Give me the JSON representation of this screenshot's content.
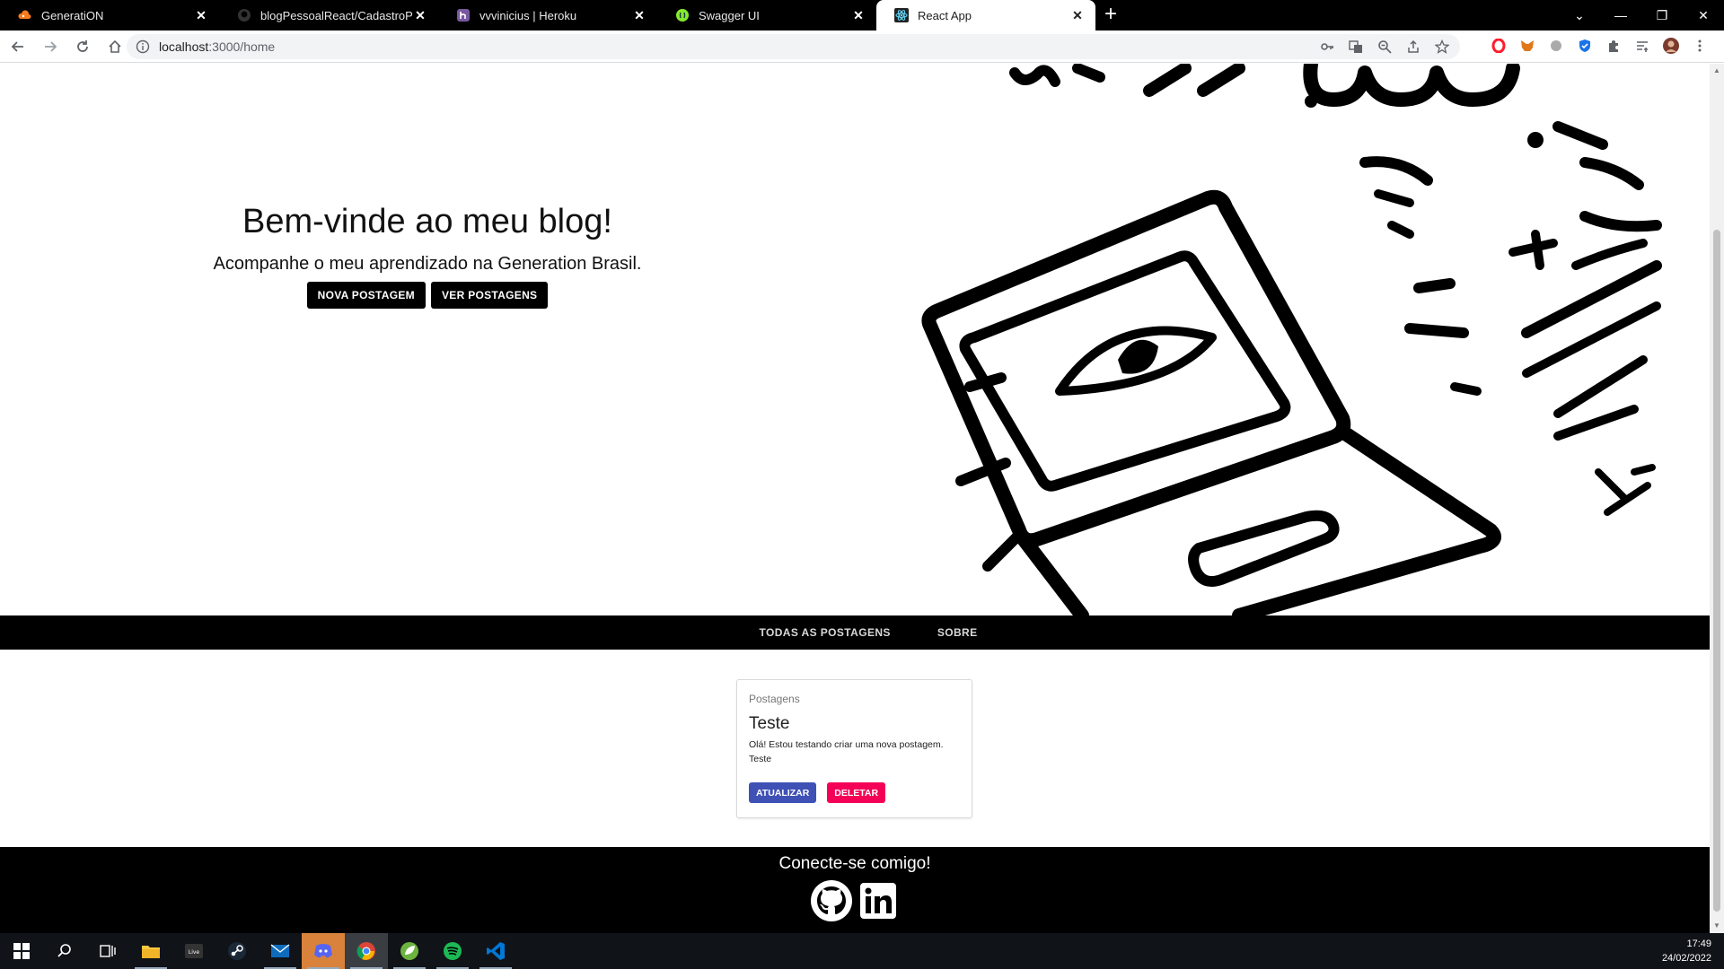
{
  "browser": {
    "tabs": [
      {
        "title": "GeneratiON",
        "icon": "cloud-icon",
        "active": false
      },
      {
        "title": "blogPessoalReact/CadastroPost.t",
        "icon": "github-icon",
        "active": false
      },
      {
        "title": "vvvinicius | Heroku",
        "icon": "heroku-icon",
        "active": false
      },
      {
        "title": "Swagger UI",
        "icon": "swagger-icon",
        "active": false
      },
      {
        "title": "React App",
        "icon": "react-icon",
        "active": true
      }
    ],
    "url_host": "localhost",
    "url_rest": ":3000/home"
  },
  "hero": {
    "title": "Bem-vinde ao meu blog!",
    "subtitle": "Acompanhe o meu aprendizado na Generation Brasil.",
    "new_post_label": "NOVA POSTAGEM",
    "see_posts_label": "VER POSTAGENS"
  },
  "navbar": {
    "all_posts": "TODAS AS POSTAGENS",
    "about": "SOBRE"
  },
  "post": {
    "label": "Postagens",
    "title": "Teste",
    "text": "Olá! Estou testando criar uma nova postagem.",
    "theme": "Teste",
    "update_label": "ATUALIZAR",
    "delete_label": "DELETAR"
  },
  "footer": {
    "title": "Conecte-se comigo!"
  },
  "taskbar": {
    "time": "17:49",
    "date": "24/02/2022"
  },
  "colors": {
    "update": "#3f51b5",
    "delete": "#f50057",
    "bar": "#000000"
  }
}
